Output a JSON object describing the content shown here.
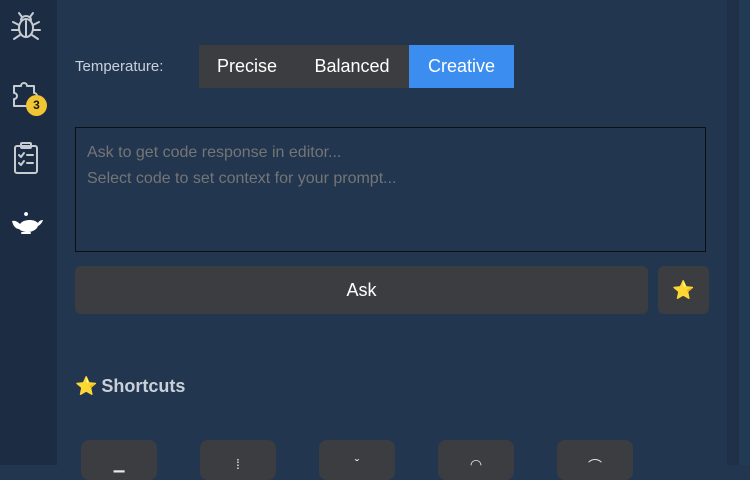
{
  "activity_bar": {
    "icons": [
      "bug-icon",
      "puzzle-extensions-icon",
      "clipboard-checklist-icon",
      "genie-lamp-icon"
    ],
    "extensions_badge": "3"
  },
  "temperature": {
    "label": "Temperature:",
    "options": [
      "Precise",
      "Balanced",
      "Creative"
    ],
    "selected": "Creative",
    "accent_color": "#3b8ef0"
  },
  "prompt": {
    "placeholder": "Ask to get code response in editor...\nSelect code to set context for your prompt..."
  },
  "actions": {
    "ask_label": "Ask",
    "star_label": "⭐"
  },
  "shortcuts": {
    "star": "⭐",
    "title": "Shortcuts",
    "tiles": [
      "shortcut-1",
      "shortcut-2",
      "shortcut-3",
      "shortcut-4",
      "shortcut-5"
    ]
  }
}
